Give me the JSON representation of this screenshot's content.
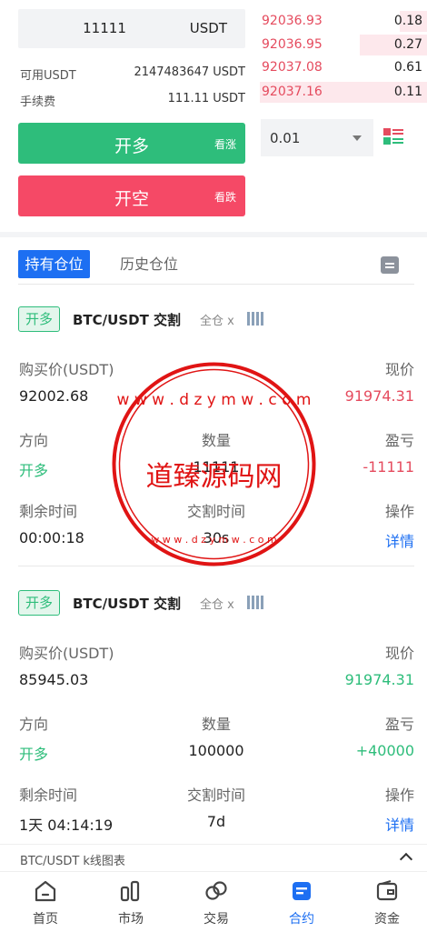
{
  "order_form": {
    "amount_value": "11111",
    "amount_unit": "USDT",
    "available_label": "可用USDT",
    "available_value": "2147483647 USDT",
    "fee_label": "手续费",
    "fee_value": "111.11 USDT",
    "long_button": {
      "label": "开多",
      "sub": "看涨"
    },
    "short_button": {
      "label": "开空",
      "sub": "看跌"
    }
  },
  "order_book": {
    "asks": [
      {
        "price": "92036.93",
        "qty": "0.18"
      },
      {
        "price": "92036.95",
        "qty": "0.27"
      },
      {
        "price": "92037.08",
        "qty": "0.61"
      },
      {
        "price": "92037.16",
        "qty": "0.11"
      }
    ],
    "depth_select": "0.01"
  },
  "tabs": {
    "active": "持有仓位",
    "other": "历史仓位"
  },
  "positions": [
    {
      "badge": "开多",
      "pair": "BTC/USDT 交割",
      "mode": "全仓 x",
      "buy_price_label": "购买价(USDT)",
      "buy_price": "92002.68",
      "current_price_label": "现价",
      "current_price": "91974.31",
      "direction_label": "方向",
      "direction": "开多",
      "quantity_label": "数量",
      "quantity": "11111",
      "pnl_label": "盈亏",
      "pnl": "-11111",
      "remaining_label": "剩余时间",
      "remaining": "00:00:18",
      "delivery_label": "交割时间",
      "delivery": "30s",
      "action_label": "操作",
      "action": "详情"
    },
    {
      "badge": "开多",
      "pair": "BTC/USDT 交割",
      "mode": "全仓 x",
      "buy_price_label": "购买价(USDT)",
      "buy_price": "85945.03",
      "current_price_label": "现价",
      "current_price": "91974.31",
      "direction_label": "方向",
      "direction": "开多",
      "quantity_label": "数量",
      "quantity": "100000",
      "pnl_label": "盈亏",
      "pnl": "+40000",
      "remaining_label": "剩余时间",
      "remaining": "1天 04:14:19",
      "delivery_label": "交割时间",
      "delivery": "7d",
      "action_label": "操作",
      "action": "详情"
    }
  ],
  "chart_toggle": "BTC/USDT k线图表",
  "watermark": {
    "title": "道臻源码网",
    "url_top": "w w w . d z y m w . c o m",
    "url_bottom": "w w w . d z y m w . c o m"
  },
  "tabbar": [
    {
      "label": "首页",
      "icon": "home-icon"
    },
    {
      "label": "市场",
      "icon": "market-icon"
    },
    {
      "label": "交易",
      "icon": "trade-icon"
    },
    {
      "label": "合约",
      "icon": "contract-icon",
      "active": true
    },
    {
      "label": "资金",
      "icon": "wallet-icon"
    }
  ],
  "colors": {
    "green": "#2ebd7b",
    "red": "#f54966",
    "blue": "#1d6ff2"
  }
}
